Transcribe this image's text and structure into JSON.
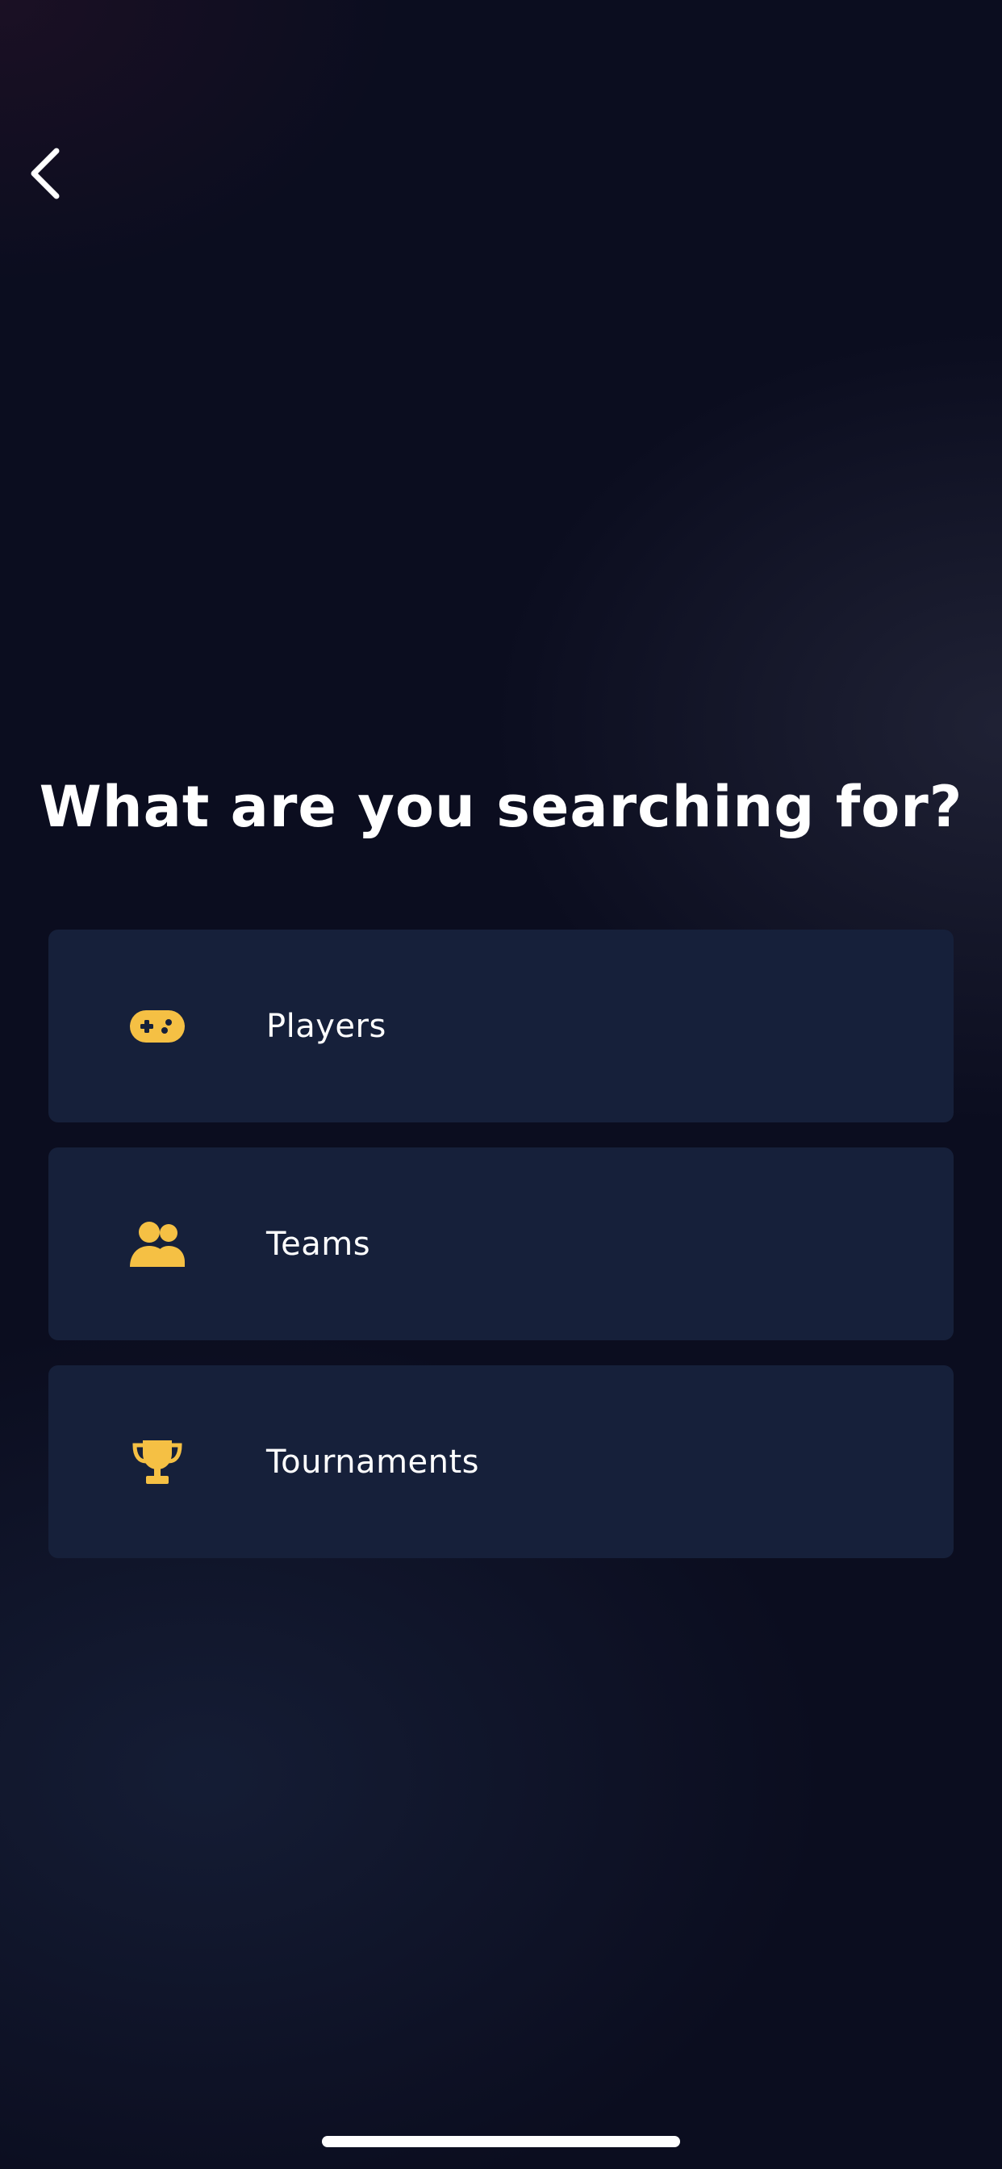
{
  "header": {
    "back_icon": "chevron-left-icon"
  },
  "title": "What are you searching for?",
  "options": [
    {
      "label": "Players",
      "icon": "gamepad-icon"
    },
    {
      "label": "Teams",
      "icon": "users-icon"
    },
    {
      "label": "Tournaments",
      "icon": "trophy-icon"
    }
  ],
  "colors": {
    "background": "#0b0d1f",
    "card": "#16203a",
    "accent": "#f5c044",
    "text": "#ffffff"
  }
}
